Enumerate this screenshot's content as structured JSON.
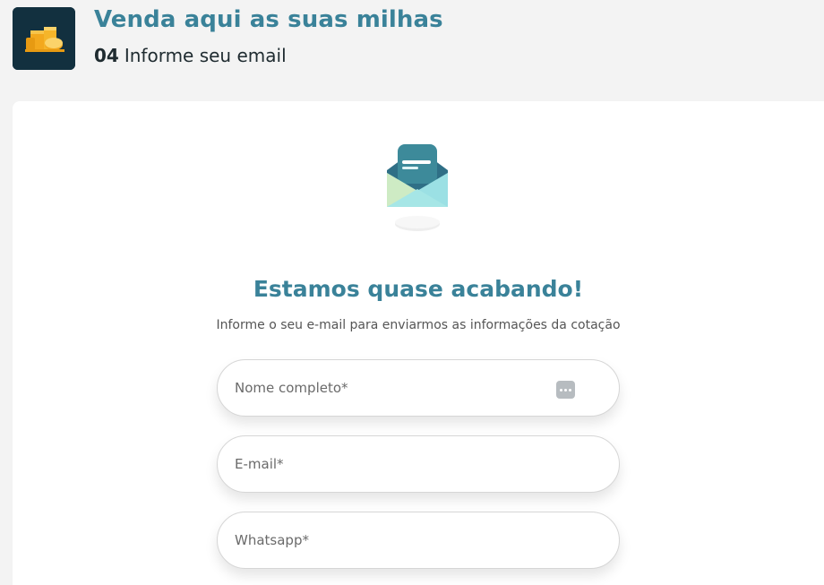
{
  "header": {
    "title": "Venda aqui as suas milhas",
    "step_number": "04",
    "step_label": "Informe seu email",
    "logo_icon": "gold-coins-icon"
  },
  "main": {
    "illustration_icon": "open-envelope-icon",
    "headline": "Estamos quase acabando!",
    "subtitle": "Informe o seu e-mail para enviarmos as informações da cotação",
    "fields": [
      {
        "placeholder": "Nome completo*",
        "value": "",
        "has_autofill_icon": true
      },
      {
        "placeholder": "E-mail*",
        "value": ""
      },
      {
        "placeholder": "Whatsapp*",
        "value": ""
      }
    ]
  },
  "colors": {
    "accent": "#3a8299",
    "logo_bg": "#12303f",
    "page_bg": "#f3f3f3",
    "text_dark": "#1f2b30"
  }
}
